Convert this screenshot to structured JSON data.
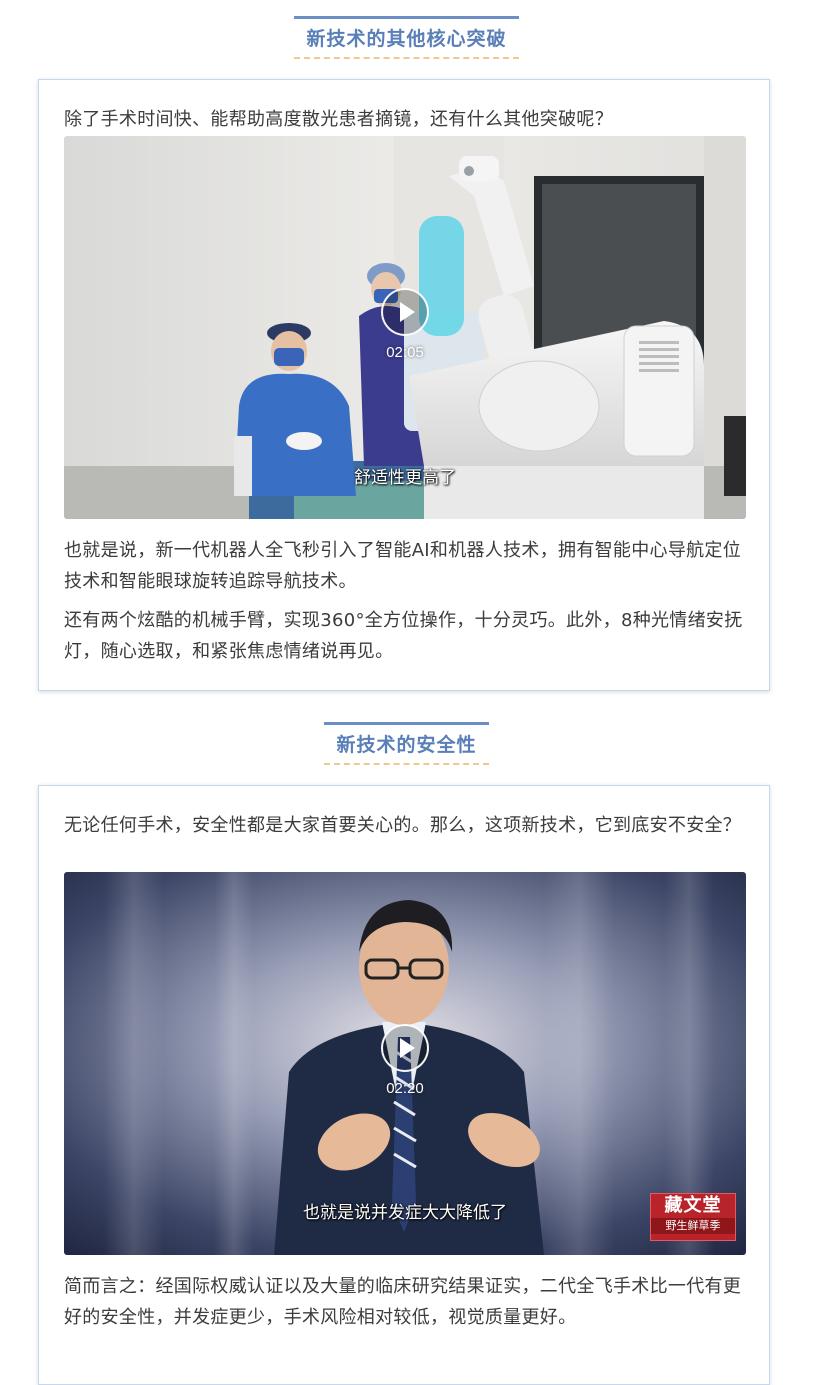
{
  "section1": {
    "title": "新技术的其他核心突破",
    "intro": "除了手术时间快、能帮助高度散光患者摘镜，还有什么其他突破呢？",
    "video": {
      "duration": "02:05",
      "subtitle": "舒适性更高了"
    },
    "para1": "也就是说，新一代机器人全飞秒引入了智能AI和机器人技术，拥有智能中心导航定位技术和智能眼球旋转追踪导航技术。",
    "para2": "还有两个炫酷的机械手臂，实现360°全方位操作，十分灵巧。此外，8种光情绪安抚灯，随心选取，和紧张焦虑情绪说再见。"
  },
  "section2": {
    "title": "新技术的安全性",
    "intro": "无论任何手术，安全性都是大家首要关心的。那么，这项新技术，它到底安不安全？",
    "video": {
      "duration": "02:20",
      "subtitle": "也就是说并发症大大降低了",
      "logo_main": "藏文堂",
      "logo_sub": "野生鲜草季"
    },
    "para1": "简而言之：经国际权威认证以及大量的临床研究结果证实，二代全飞手术比一代有更好的安全性，并发症更少，手术风险相对较低，视觉质量更好。"
  },
  "colors": {
    "title_text": "#5a7fb8",
    "title_top_rule": "#6b8ec4",
    "title_dash": "#f0c88e",
    "card_border": "#c9d7ea"
  }
}
